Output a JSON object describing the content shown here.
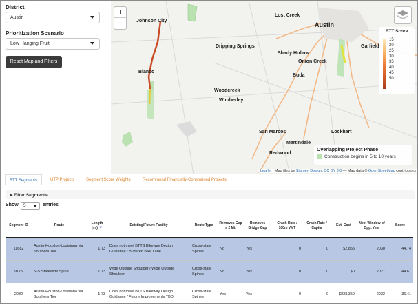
{
  "filters": {
    "district_label": "District",
    "district_value": "Austin",
    "scenario_label": "Prioritization Scenario",
    "scenario_value": "Low Hanging Fruit",
    "reset_label": "Reset Map and Filters"
  },
  "map": {
    "zoom_in": "+",
    "zoom_out": "−",
    "cities": [
      "Johnson City",
      "Lost Creek",
      "Austin",
      "Dripping Springs",
      "Shady Hollow",
      "Garfield",
      "Blanco",
      "Onion Creek",
      "Buda",
      "Woodcreek",
      "Wimberley",
      "San Marcos",
      "Lockhart",
      "Martindale",
      "Redwood"
    ],
    "legend_title": "BTT Score",
    "legend_ticks": [
      "15",
      "20",
      "25",
      "30",
      "35",
      "40",
      "45",
      "50"
    ],
    "overlap_title": "Overlapping Project Phase",
    "overlap_item": "Construction begins in 5 to 10 years",
    "overlap_color": "#b9e2b0",
    "attribution_leaflet": "Leaflet",
    "attribution_mid": " | Map tiles by ",
    "attribution_stamen": "Stamen Design",
    "attribution_sep": ", ",
    "attribution_cc": "CC BY 3.0",
    "attribution_tail": " — Map data © ",
    "attribution_osm": "OpenStreetMap",
    "attribution_end": " contributors"
  },
  "tabs": [
    "BTT Segments",
    "UTP Projects",
    "Segment Score Weights",
    "Recommend Financially-Constrained Projects"
  ],
  "filter_segments": "▸ Filter Segments",
  "show": {
    "prefix": "Show",
    "value": "5",
    "suffix": "entries"
  },
  "table": {
    "headers": [
      "Segment ID",
      "Route",
      "Length (mi)",
      "Existing/Future Facility",
      "Route Type",
      "Removes Gap ≥ 2 Mi.",
      "Removes Bridge Gap",
      "Crash Rate / 100m VMT",
      "Crash Rate / Capita",
      "Est. Cost",
      "Next Window of Opp. Year",
      "Score"
    ],
    "rows": [
      [
        "11682",
        "Austin-Houston-Louisiana via Southern Tier",
        "1.73",
        "Does not meet BTTS Bikeway Design Guidance / Buffered Bike Lane",
        "Cross-state Spines",
        "No",
        "Yes",
        "0",
        "0",
        "$2,855",
        "2030",
        "44.74"
      ],
      [
        "9175",
        "N-S Statewide Spine",
        "1.73",
        "Wide Outside Shoulder / Wide Outside Shoulder",
        "Cross-state Spines",
        "No",
        "Yes",
        "0",
        "0",
        "$0",
        "2027",
        "44.61"
      ],
      [
        "2032",
        "Austin-Houston-Louisiana via Southern Tier",
        "1.73",
        "Does not meet BTTS Bikeway Design Guidance / Future Improvements TBD",
        "Cross-state Spines",
        "Yes",
        "Yes",
        "0",
        "0",
        "$838,359",
        "2022",
        "36.41"
      ]
    ]
  }
}
